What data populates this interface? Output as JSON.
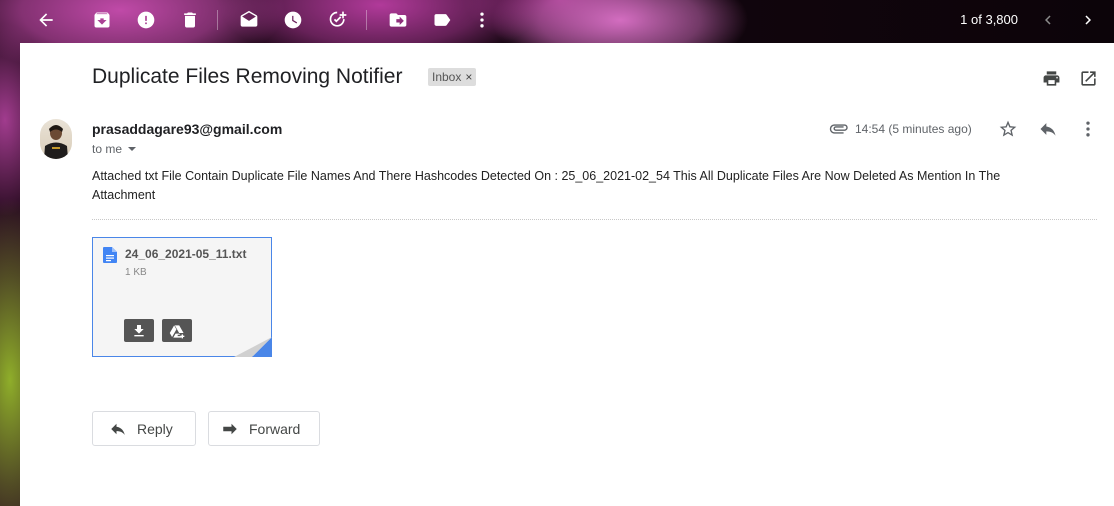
{
  "toolbar": {
    "buttons": [
      "back-arrow-icon",
      "archive-icon",
      "report-spam-icon",
      "delete-icon",
      "mark-unread-icon",
      "snooze-icon",
      "add-to-tasks-icon",
      "move-to-icon",
      "labels-icon",
      "more-vert-icon"
    ],
    "page_count": "1 of 3,800"
  },
  "email": {
    "subject": "Duplicate Files Removing Notifier",
    "label": "Inbox",
    "label_close": "×",
    "sender": "prasaddagare93@gmail.com",
    "to": "to me",
    "timestamp": "14:54 (5 minutes ago)",
    "body": "Attached txt File Contain Duplicate File Names And There Hashcodes Detected On : 25_06_2021-02_54 This All Duplicate Files Are Now Deleted As Mention In The Attachment"
  },
  "attachment": {
    "filename": "24_06_2021-05_11.txt",
    "size": "1 KB"
  },
  "actions": {
    "reply": "Reply",
    "forward": "Forward"
  },
  "colors": {
    "attachment_border": "#4a86e8",
    "doc_icon": "#4285f4"
  }
}
